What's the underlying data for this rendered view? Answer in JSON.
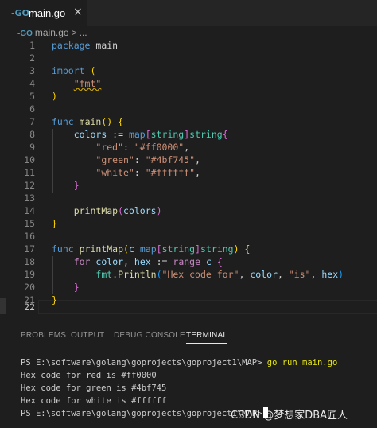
{
  "tab": {
    "icon": "go-file-icon",
    "title": "main.go",
    "close": "×"
  },
  "breadcrumb": {
    "file": "main.go",
    "sep": ">",
    "more": "..."
  },
  "editor": {
    "line_numbers": [
      "1",
      "2",
      "3",
      "4",
      "5",
      "6",
      "7",
      "8",
      "9",
      "10",
      "11",
      "12",
      "13",
      "14",
      "15",
      "16",
      "17",
      "18",
      "19",
      "20",
      "21",
      "22"
    ],
    "active_line": "22"
  },
  "panel": {
    "tabs": [
      "PROBLEMS",
      "OUTPUT",
      "DEBUG CONSOLE",
      "TERMINAL"
    ],
    "active_tab": "TERMINAL"
  },
  "terminal": {
    "prompt": "PS E:\\software\\golang\\goprojects\\goproject1\\MAP>",
    "command": "go run main.go",
    "output": [
      "Hex code for red is #ff0000",
      "Hex code for green is #4bf745",
      "Hex code for white is #ffffff"
    ]
  },
  "watermark": "CSDN @梦想家DBA匠人",
  "colors": {
    "keyword": "#569cd6",
    "string": "#ce9178",
    "function": "#dcdcaa",
    "variable": "#9cdcfe",
    "type": "#4ec9b0",
    "control": "#c586c0",
    "background": "#1e1e1e"
  }
}
